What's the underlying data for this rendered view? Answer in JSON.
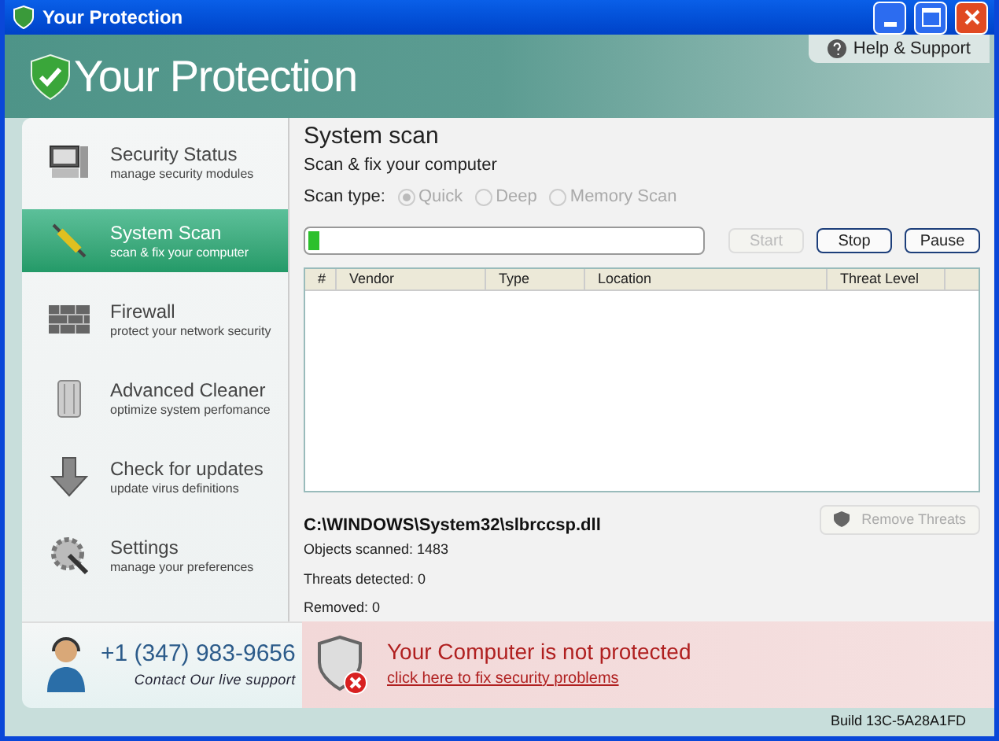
{
  "window": {
    "title": "Your Protection"
  },
  "header": {
    "title": "Your Protection",
    "help_button": "Help & Support"
  },
  "sidebar": {
    "items": [
      {
        "title": "Security Status",
        "subtitle": "manage security modules",
        "selected": false
      },
      {
        "title": "System Scan",
        "subtitle": "scan & fix your computer",
        "selected": true
      },
      {
        "title": "Firewall",
        "subtitle": "protect your network security",
        "selected": false
      },
      {
        "title": "Advanced Cleaner",
        "subtitle": "optimize system perfomance",
        "selected": false
      },
      {
        "title": "Check for updates",
        "subtitle": "update virus definitions",
        "selected": false
      },
      {
        "title": "Settings",
        "subtitle": "manage your preferences",
        "selected": false
      }
    ]
  },
  "main": {
    "title": "System scan",
    "subtitle": "Scan & fix your computer",
    "scan_type_label": "Scan type:",
    "scan_types": [
      {
        "label": "Quick",
        "selected": true,
        "disabled": true
      },
      {
        "label": "Deep",
        "selected": false,
        "disabled": true
      },
      {
        "label": "Memory Scan",
        "selected": false,
        "disabled": true
      }
    ],
    "progress": {
      "level": 0.03
    },
    "buttons": [
      {
        "label": "Start",
        "disabled": true
      },
      {
        "label": "Stop",
        "disabled": false
      },
      {
        "label": "Pause",
        "disabled": false
      }
    ],
    "table": {
      "columns": [
        "#",
        "Vendor",
        "Type",
        "Location",
        "Threat Level"
      ]
    },
    "current_file": "C:\\WINDOWS\\System32\\slbrccsp.dll",
    "remove_button": {
      "label": "Remove Threats",
      "disabled": true
    },
    "stats": [
      "Objects scanned: 1483",
      "Threats detected: 0",
      "Removed: 0"
    ]
  },
  "support": {
    "phone": "+1 (347) 983-9656",
    "caption": "Contact Our live support"
  },
  "alert": {
    "title": "Your Computer is not protected",
    "link": "click here to fix security problems"
  },
  "status_bar": {
    "build": "Build 13C-5A28A1FD"
  }
}
